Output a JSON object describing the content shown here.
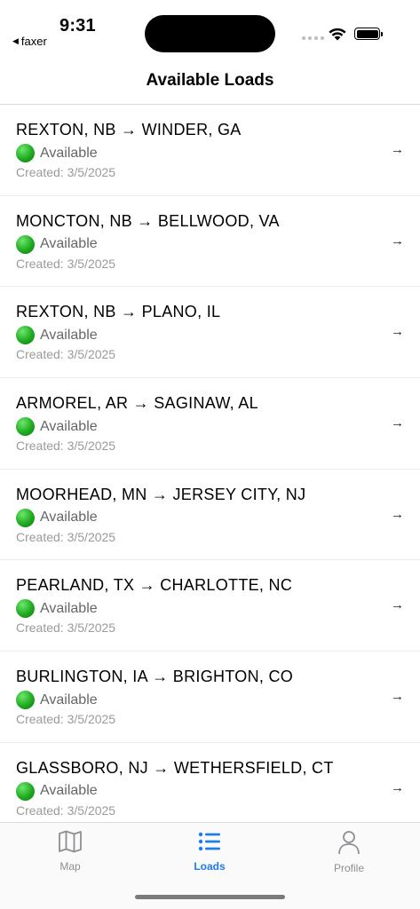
{
  "status_bar": {
    "time": "9:31",
    "back_app": "faxer"
  },
  "nav": {
    "title": "Available Loads"
  },
  "loads": [
    {
      "route": "REXTON, NB → WINDER, GA",
      "status": "Available",
      "created": "Created: 3/5/2025"
    },
    {
      "route": "MONCTON, NB → BELLWOOD, VA",
      "status": "Available",
      "created": "Created: 3/5/2025"
    },
    {
      "route": "REXTON, NB → PLANO, IL",
      "status": "Available",
      "created": "Created: 3/5/2025"
    },
    {
      "route": "ARMOREL, AR → SAGINAW, AL",
      "status": "Available",
      "created": "Created: 3/5/2025"
    },
    {
      "route": "MOORHEAD, MN → JERSEY CITY, NJ",
      "status": "Available",
      "created": "Created: 3/5/2025"
    },
    {
      "route": "PEARLAND, TX → CHARLOTTE, NC",
      "status": "Available",
      "created": "Created: 3/5/2025"
    },
    {
      "route": "BURLINGTON, IA → BRIGHTON, CO",
      "status": "Available",
      "created": "Created: 3/5/2025"
    },
    {
      "route": "GLASSBORO, NJ → WETHERSFIELD, CT",
      "status": "Available",
      "created": "Created: 3/5/2025"
    }
  ],
  "tabbar": {
    "tabs": [
      {
        "label": "Map",
        "icon": "map-icon",
        "active": false
      },
      {
        "label": "Loads",
        "icon": "list-icon",
        "active": true
      },
      {
        "label": "Profile",
        "icon": "person-icon",
        "active": false
      }
    ]
  },
  "colors": {
    "accent": "#1e7bf0",
    "available_dot": "#1faa1f",
    "inactive_tab": "#8e8e93"
  }
}
